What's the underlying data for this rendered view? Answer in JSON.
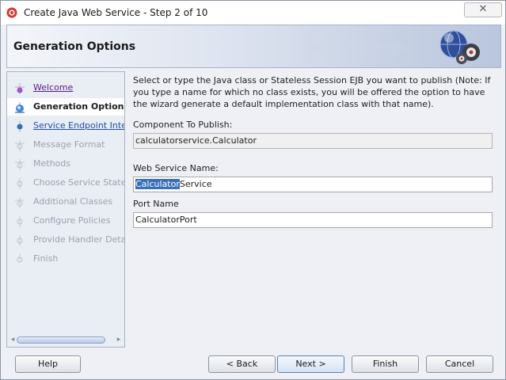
{
  "window": {
    "title": "Create Java Web Service - Step 2 of 10",
    "close_glyph": "✕"
  },
  "banner": {
    "title": "Generation Options",
    "bits": "01010101010101010101010101"
  },
  "steps": [
    {
      "label": "Welcome",
      "state": "visited"
    },
    {
      "label": "Generation Options",
      "state": "current"
    },
    {
      "label": "Service Endpoint Interfa",
      "state": "link"
    },
    {
      "label": "Message Format",
      "state": "disabled"
    },
    {
      "label": "Methods",
      "state": "disabled"
    },
    {
      "label": "Choose Service State",
      "state": "disabled"
    },
    {
      "label": "Additional Classes",
      "state": "disabled"
    },
    {
      "label": "Configure Policies",
      "state": "disabled"
    },
    {
      "label": "Provide Handler Details",
      "state": "disabled"
    },
    {
      "label": "Finish",
      "state": "disabled"
    }
  ],
  "scroll": {
    "left_arrow": "◂",
    "right_arrow": "▸"
  },
  "content": {
    "description": "Select or type the Java class or Stateless Session EJB you want to publish (Note: If you type a name for which no class exists, you will be offered the option to have the wizard generate a default implementation class with that name).",
    "component_label": "Component To Publish:",
    "component_value": "calculatorservice.Calculator",
    "service_name_label": "Web Service Name:",
    "service_name_selected": "Calculator",
    "service_name_rest": "Service",
    "port_name_label": "Port Name",
    "port_name_value": "CalculatorPort"
  },
  "buttons": {
    "help": "Help",
    "back": "< Back",
    "next": "Next >",
    "finish": "Finish",
    "cancel": "Cancel"
  }
}
